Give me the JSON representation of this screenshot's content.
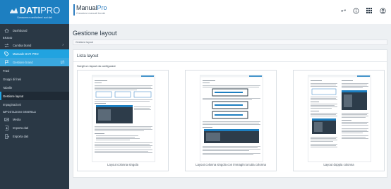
{
  "brand": {
    "name_main": "DATI",
    "name_pro": "PRO",
    "tagline": "Conoscere e condividere i suoi dati"
  },
  "sidebar": {
    "dashboard": "Dashboard",
    "section_brand": "BRAND",
    "cambia_brand": "Cambia brand",
    "manuale": "Manuale DATI PRO",
    "gestione_brand": "Gestione brand",
    "frasi": "Frasi",
    "gruppi_frasi": "Gruppi di frasi",
    "tabelle": "Tabelle",
    "gestione_layout": "Gestione layout",
    "impaginazioni": "Impaginazioni",
    "section_settings": "IMPOSTAZIONI GENERALI",
    "media": "Media",
    "importa": "Importa dati",
    "esporta": "Esporta dati"
  },
  "topbar": {
    "app_title_main": "Manual",
    "app_title_pro": "Pro",
    "app_subtitle": "Creazione manuali tecnici",
    "lang": "IT"
  },
  "page": {
    "title": "Gestione layout",
    "breadcrumb": "Gestione layout"
  },
  "card": {
    "title": "Lista layout",
    "subtitle": "Scegli un layout da configurare",
    "layouts": [
      {
        "label": "Layout colonna singola"
      },
      {
        "label": "Layout colonna singola con immagini a tutta colonna"
      },
      {
        "label": "Layout doppia colonna"
      }
    ]
  },
  "colors": {
    "sidebar_bg": "#2a3845",
    "brand_bg": "#1d7fc1",
    "highlight": "#21a3e0",
    "page_bg": "#edf0f3"
  }
}
